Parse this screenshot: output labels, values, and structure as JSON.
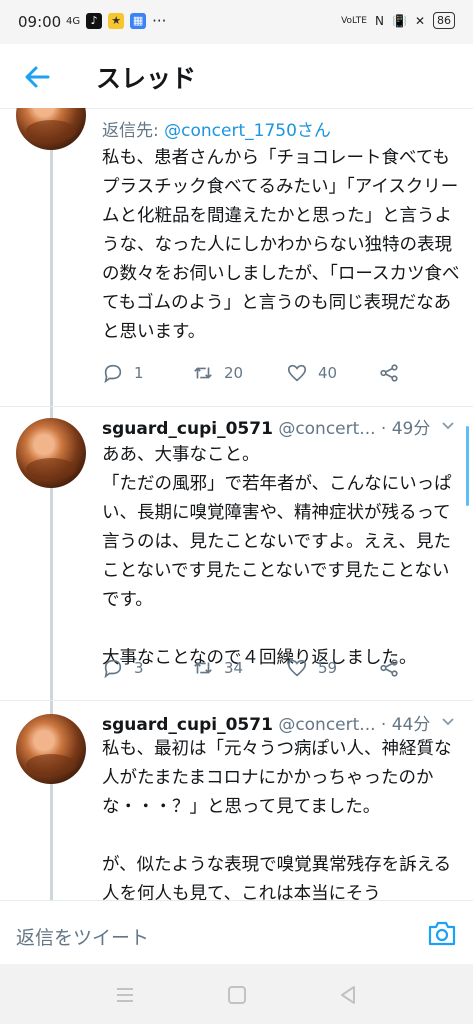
{
  "status_bar": {
    "time": "09:00",
    "network": "4G",
    "battery": "86",
    "volte": "VoLTE"
  },
  "app_bar": {
    "title": "スレッド"
  },
  "tweets": [
    {
      "reply_prefix": "返信先: ",
      "reply_handle": "@concert_1750さん",
      "text": "私も、患者さんから「チョコレート食べてもプラスチック食べてるみたい」「アイスクリームと化粧品を間違えたかと思った」と言うような、なった人にしかわからない独特の表現の数々をお伺いしましたが、「ロースカツ食べてもゴムのよう」と言うのも同じ表現だなあと思います。",
      "replies": "1",
      "retweets": "20",
      "likes": "40"
    },
    {
      "name": "sguard_cupi_0571",
      "handle": "@concert...",
      "time": "· 49分",
      "text": "ああ、大事なこと。\n「ただの風邪」で若年者が、こんなにいっぱい、長期に嗅覚障害や、精神症状が残るって言うのは、見たことないですよ。ええ、見たことないです見たことないです見たことないです。\n\n大事なことなので４回繰り返しました。",
      "replies": "3",
      "retweets": "34",
      "likes": "59"
    },
    {
      "name": "sguard_cupi_0571",
      "handle": "@concert...",
      "time": "· 44分",
      "text": "私も、最初は「元々うつ病ぽい人、神経質な人がたまたまコロナにかかっちゃったのかな・・・？」と思って見てました。\n\nが、似たような表現で嗅覚異常残存を訴える人を何人も見て、これは本当にそう"
    }
  ],
  "composer": {
    "placeholder": "返信をツイート"
  },
  "icons": {
    "back": "arrow-left-icon",
    "reply": "reply-icon",
    "retweet": "retweet-icon",
    "like": "heart-icon",
    "share": "share-icon",
    "camera": "camera-icon"
  },
  "colors": {
    "accent": "#1da1f2",
    "muted": "#657786",
    "text": "#14171a"
  }
}
